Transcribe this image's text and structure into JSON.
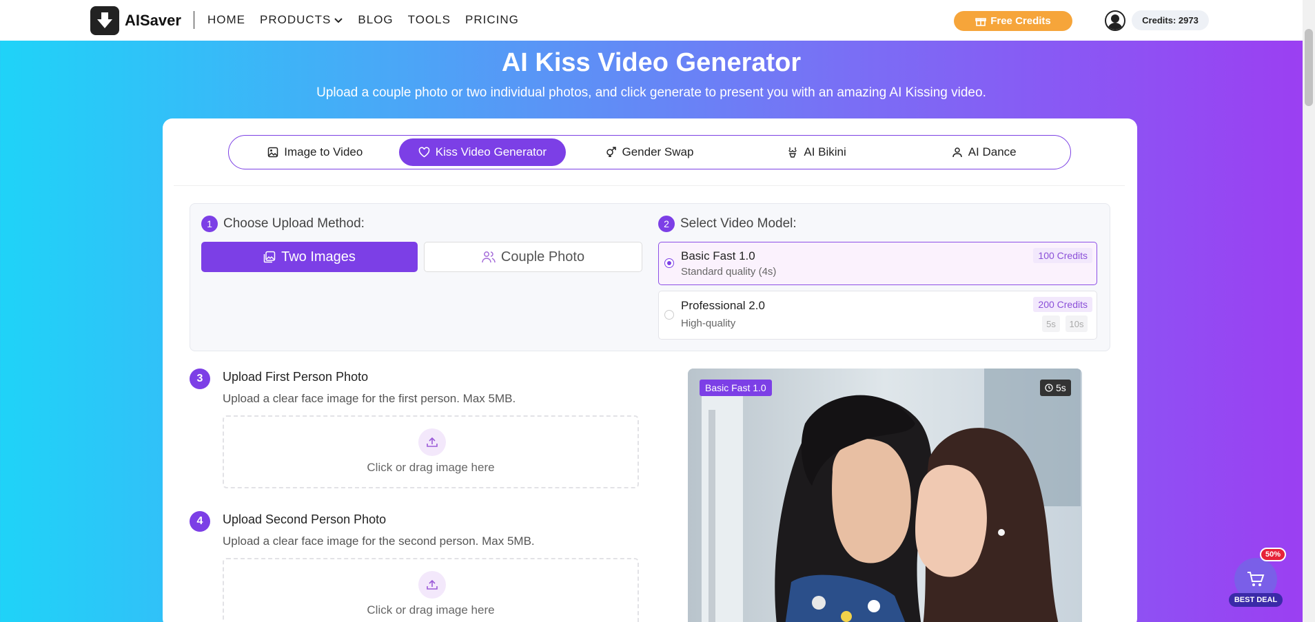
{
  "nav": {
    "brand": "AISaver",
    "menu": [
      {
        "label": "HOME"
      },
      {
        "label": "PRODUCTS"
      },
      {
        "label": "BLOG"
      },
      {
        "label": "TOOLS"
      },
      {
        "label": "PRICING"
      }
    ],
    "free_credits": "Free Credits",
    "credits": "Credits: 2973"
  },
  "hero": {
    "title": "AI Kiss Video Generator",
    "subtitle": "Upload a couple photo or two individual photos, and click generate to present you with an amazing AI Kissing video."
  },
  "tabs": [
    {
      "label": "Image to Video",
      "icon": "image-icon"
    },
    {
      "label": "Kiss Video Generator",
      "icon": "heart-icon",
      "active": true
    },
    {
      "label": "Gender Swap",
      "icon": "gender-icon"
    },
    {
      "label": "AI Bikini",
      "icon": "bikini-icon"
    },
    {
      "label": "AI Dance",
      "icon": "person-icon"
    }
  ],
  "upload_method": {
    "step": "1",
    "title": "Choose Upload Method:",
    "two_images": "Two Images",
    "couple_photo": "Couple Photo"
  },
  "video_model": {
    "step": "2",
    "title": "Select Video Model:",
    "models": [
      {
        "name": "Basic Fast 1.0",
        "desc": "Standard quality (4s)",
        "credits": "100 Credits",
        "selected": true
      },
      {
        "name": "Professional 2.0",
        "desc": "High-quality",
        "credits": "200 Credits",
        "selected": false,
        "durations": [
          "5s",
          "10s"
        ]
      }
    ]
  },
  "uploads": [
    {
      "step": "3",
      "title": "Upload First Person Photo",
      "desc": "Upload a clear face image for the first person. Max 5MB.",
      "drop": "Click or drag image here"
    },
    {
      "step": "4",
      "title": "Upload Second Person Photo",
      "desc": "Upload a clear face image for the second person. Max 5MB.",
      "drop": "Click or drag image here"
    }
  ],
  "preview": {
    "model_badge": "Basic Fast 1.0",
    "duration_badge": "5s"
  },
  "deal": {
    "percent": "50%",
    "label": "BEST DEAL"
  },
  "colors": {
    "accent": "#7c3fe6",
    "free_credits_bg": "#f6a53a"
  }
}
